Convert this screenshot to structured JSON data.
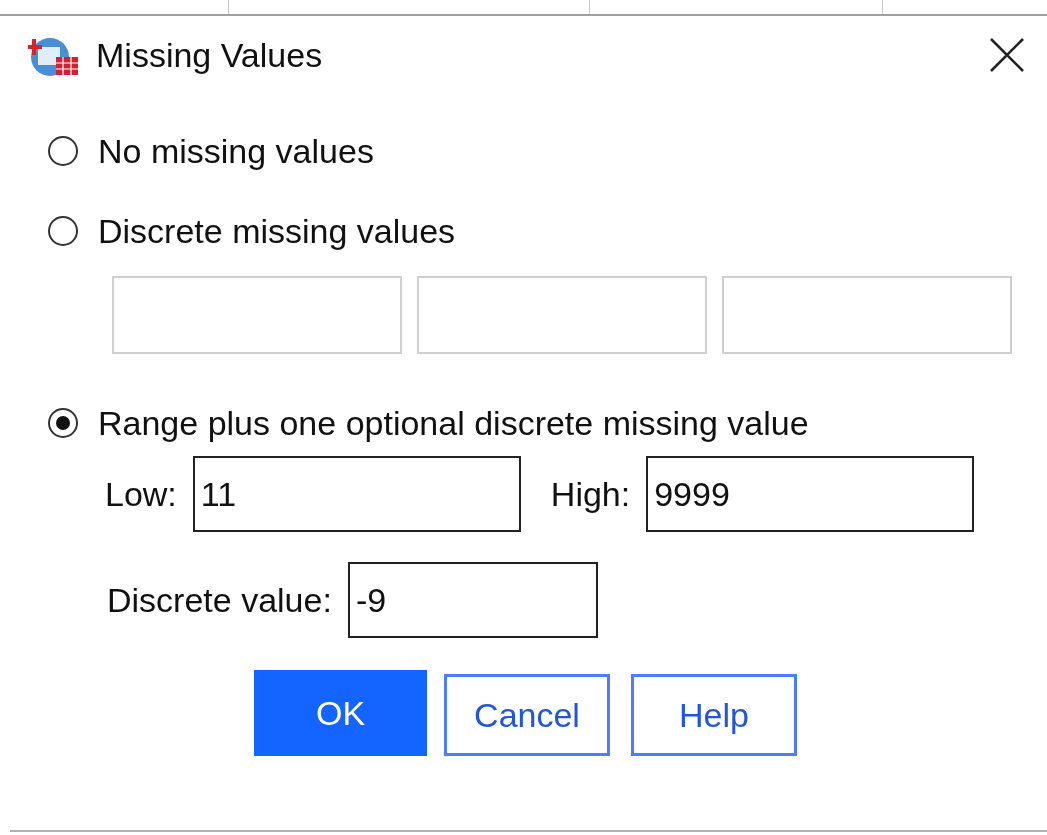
{
  "window": {
    "title": "Missing Values"
  },
  "options": [
    {
      "label": "No missing values",
      "selected": false
    },
    {
      "label": "Discrete missing values",
      "selected": false
    },
    {
      "label": "Range plus one optional discrete missing value",
      "selected": true
    }
  ],
  "discrete_fields": [
    {
      "disabled": true
    },
    {
      "disabled": true
    },
    {
      "disabled": true
    }
  ],
  "range": {
    "low_label": "Low:",
    "low": "11",
    "high_label": "High:",
    "high": "9999",
    "discrete_label": "Discrete value:",
    "discrete": "-9"
  },
  "buttons": [
    {
      "label": "OK",
      "kind": "primary"
    },
    {
      "label": "Cancel",
      "kind": "secondary"
    },
    {
      "label": "Help",
      "kind": "secondary"
    }
  ]
}
